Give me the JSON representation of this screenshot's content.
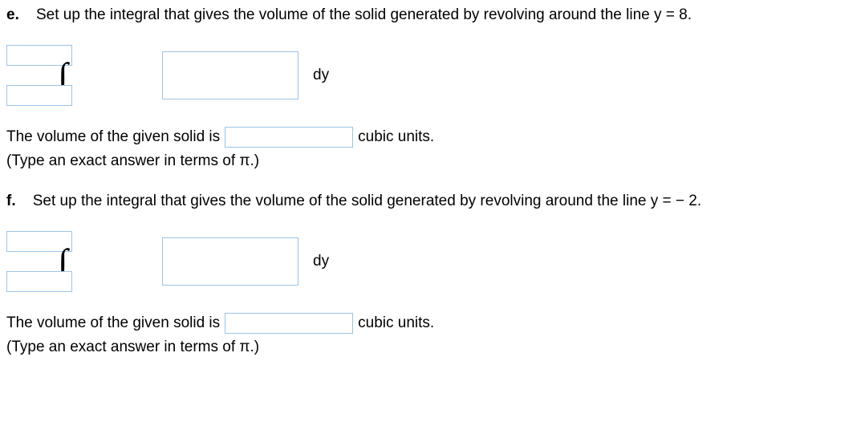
{
  "partE": {
    "label": "e.",
    "question": "Set up the integral that gives the volume of the solid generated by revolving around the line y = 8.",
    "dy": "dy",
    "answerPrefix": "The volume of the given solid is",
    "answerSuffix": "cubic units.",
    "hint": "(Type an exact answer in terms of π.)"
  },
  "partF": {
    "label": "f.",
    "question": "Set up the integral that gives the volume of the solid generated by revolving around the line y = − 2.",
    "dy": "dy",
    "answerPrefix": "The volume of the given solid is",
    "answerSuffix": "cubic units.",
    "hint": "(Type an exact answer in terms of π.)"
  },
  "integralSymbol": "∫"
}
